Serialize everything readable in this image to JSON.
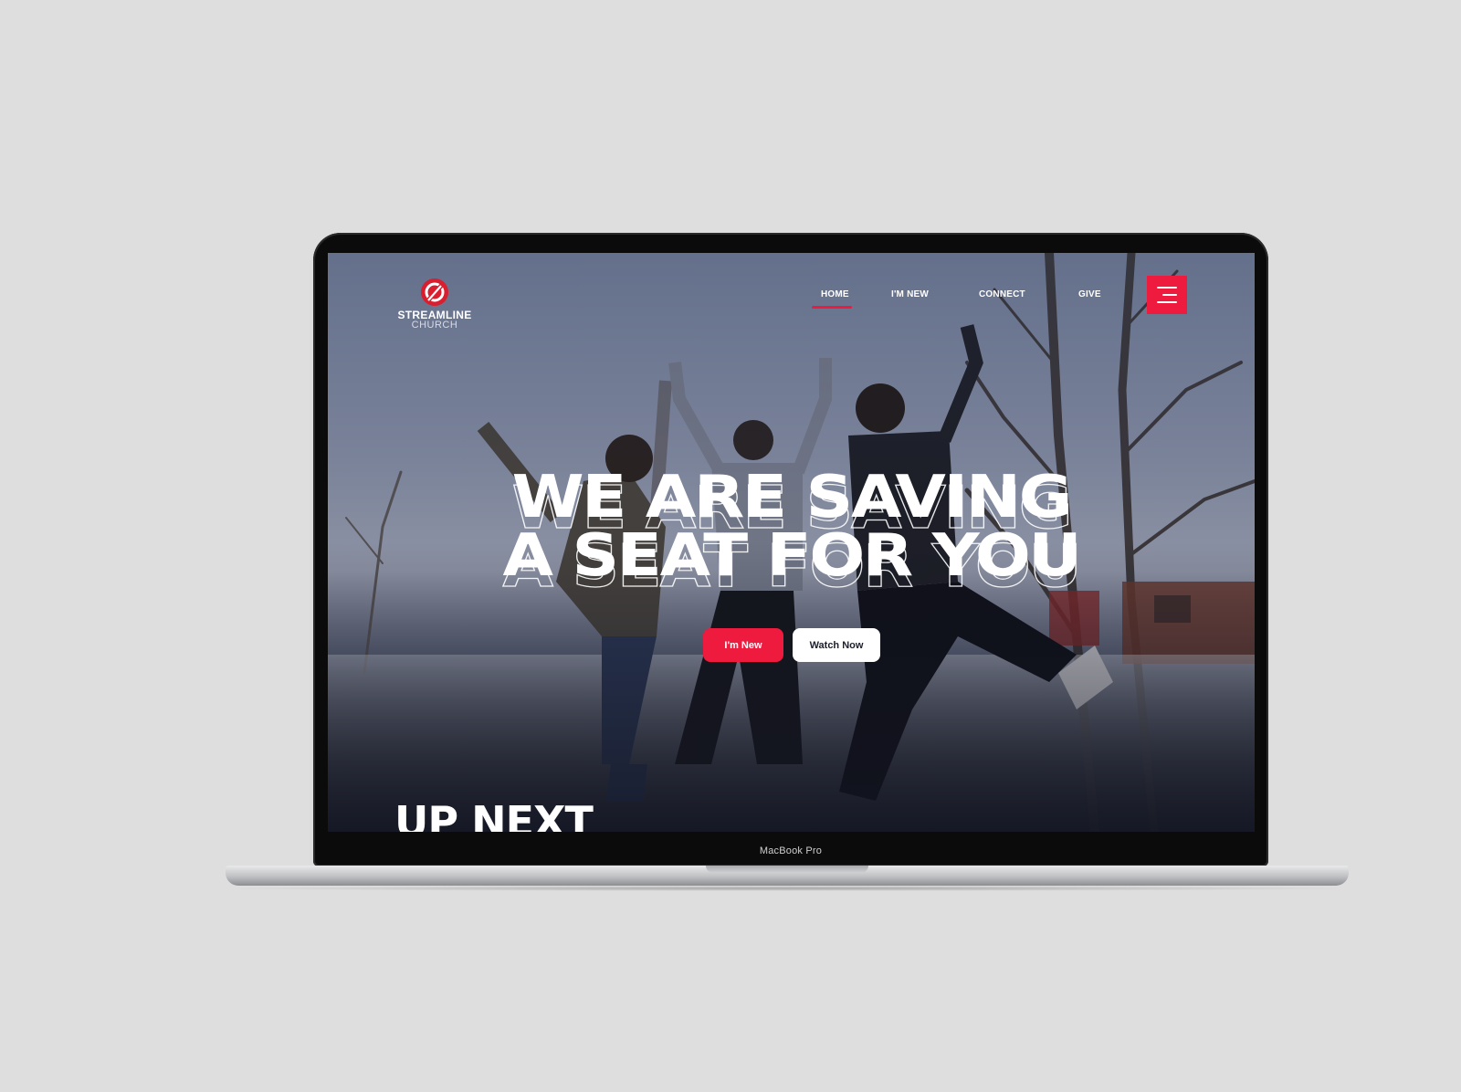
{
  "device": {
    "model_label": "MacBook Pro"
  },
  "brand": {
    "name_line1": "STREAMLINE",
    "name_line2": "CHURCH",
    "accent_color": "#ee1b3f"
  },
  "nav": {
    "items": [
      {
        "label": "HOME",
        "active": true
      },
      {
        "label": "I'M NEW",
        "active": false
      },
      {
        "label": "CONNECT",
        "active": false
      },
      {
        "label": "GIVE",
        "active": false
      }
    ],
    "menu_icon": "hamburger-menu-icon"
  },
  "hero": {
    "headline_line1": "WE ARE SAVING",
    "headline_line2": "A SEAT FOR YOU",
    "primary_button": "I'm New",
    "secondary_button": "Watch Now"
  },
  "next_section": {
    "title": "UP NEXT"
  }
}
